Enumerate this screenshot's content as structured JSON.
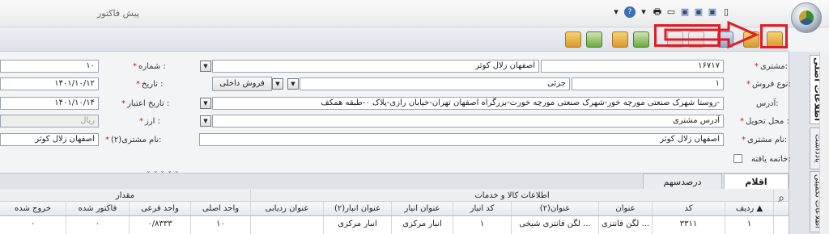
{
  "window": {
    "title": "پیش فاکتور"
  },
  "quick_access": {
    "icons": [
      "new-doc-icon",
      "save-icon",
      "save-as-icon",
      "open-icon",
      "print-icon",
      "help-icon",
      "minimize-icon"
    ]
  },
  "ribbon": {
    "icons": [
      "archive-icon",
      "delete-icon",
      "calc-icon",
      "lock-icon",
      "print-preview-icon",
      "export-icon",
      "attach-icon",
      "import-icon",
      "close-icon"
    ]
  },
  "side_tabs": [
    "اطلاعات اصلی",
    "یادداشت",
    "اطلاعات تکمیلی"
  ],
  "form": {
    "customer": {
      "label": "مشتری:",
      "code": "۱۶۷۱۷",
      "name": "اصفهان زلال کوثر"
    },
    "number": {
      "label": "شماره :",
      "value": "۱۰"
    },
    "sale_type": {
      "label": "نوع فروش:",
      "code": "۱",
      "name": "جزئی",
      "button": "فروش داخلی"
    },
    "date": {
      "label": "تاریخ :",
      "value": "۱۴۰۱/۱۰/۱۲"
    },
    "address": {
      "label": "آدرس:",
      "value": "روستا شهرک صنعتی مورچه خور-شهرک صنعتی مورچه خورت-بزرگراه اصفهان تهران-خیابان رازی-پلاک ۰-طبقه همکف-"
    },
    "validity_date": {
      "label": "تاریخ اعتبار :",
      "value": "۱۴۰۱/۱۰/۱۴"
    },
    "delivery": {
      "label": "محل تحویل :",
      "value": "آدرس مشتری"
    },
    "currency": {
      "label": "ارز :",
      "value": "ریال"
    },
    "customer_name": {
      "label": "نام مشتری:",
      "value": "اصفهان زلال کوثر"
    },
    "customer_name2": {
      "label": "نام مشتری(۲):",
      "value": "اصفهان زلال کوثر"
    },
    "finalized": {
      "label": "خاتمه یافته:"
    }
  },
  "grid_tabs": [
    "اقلام",
    "درصدسهم"
  ],
  "grid": {
    "groups": {
      "goods": "اطلاعات کالا و خدمات",
      "quantity": "مقدار"
    },
    "columns": [
      "ردیف",
      "کد",
      "عنوان",
      "عنوان(۲)",
      "کد انبار",
      "عنوان انبار",
      "عنوان انبار(۲)",
      "عنوان ردیابی",
      "واحد اصلی",
      "واحد فرعی",
      "فاکتور شده",
      "خروج شده"
    ],
    "rows": [
      [
        "۱",
        "۳۳۱۱",
        "لگن فانتزی ...",
        "لگن فانتزی شیخی ...",
        "۱",
        "انبار مرکزی",
        "انبار مرکزی",
        "",
        "۱۰",
        "۰/۸۳۳۳",
        "۰",
        "۰"
      ]
    ]
  }
}
